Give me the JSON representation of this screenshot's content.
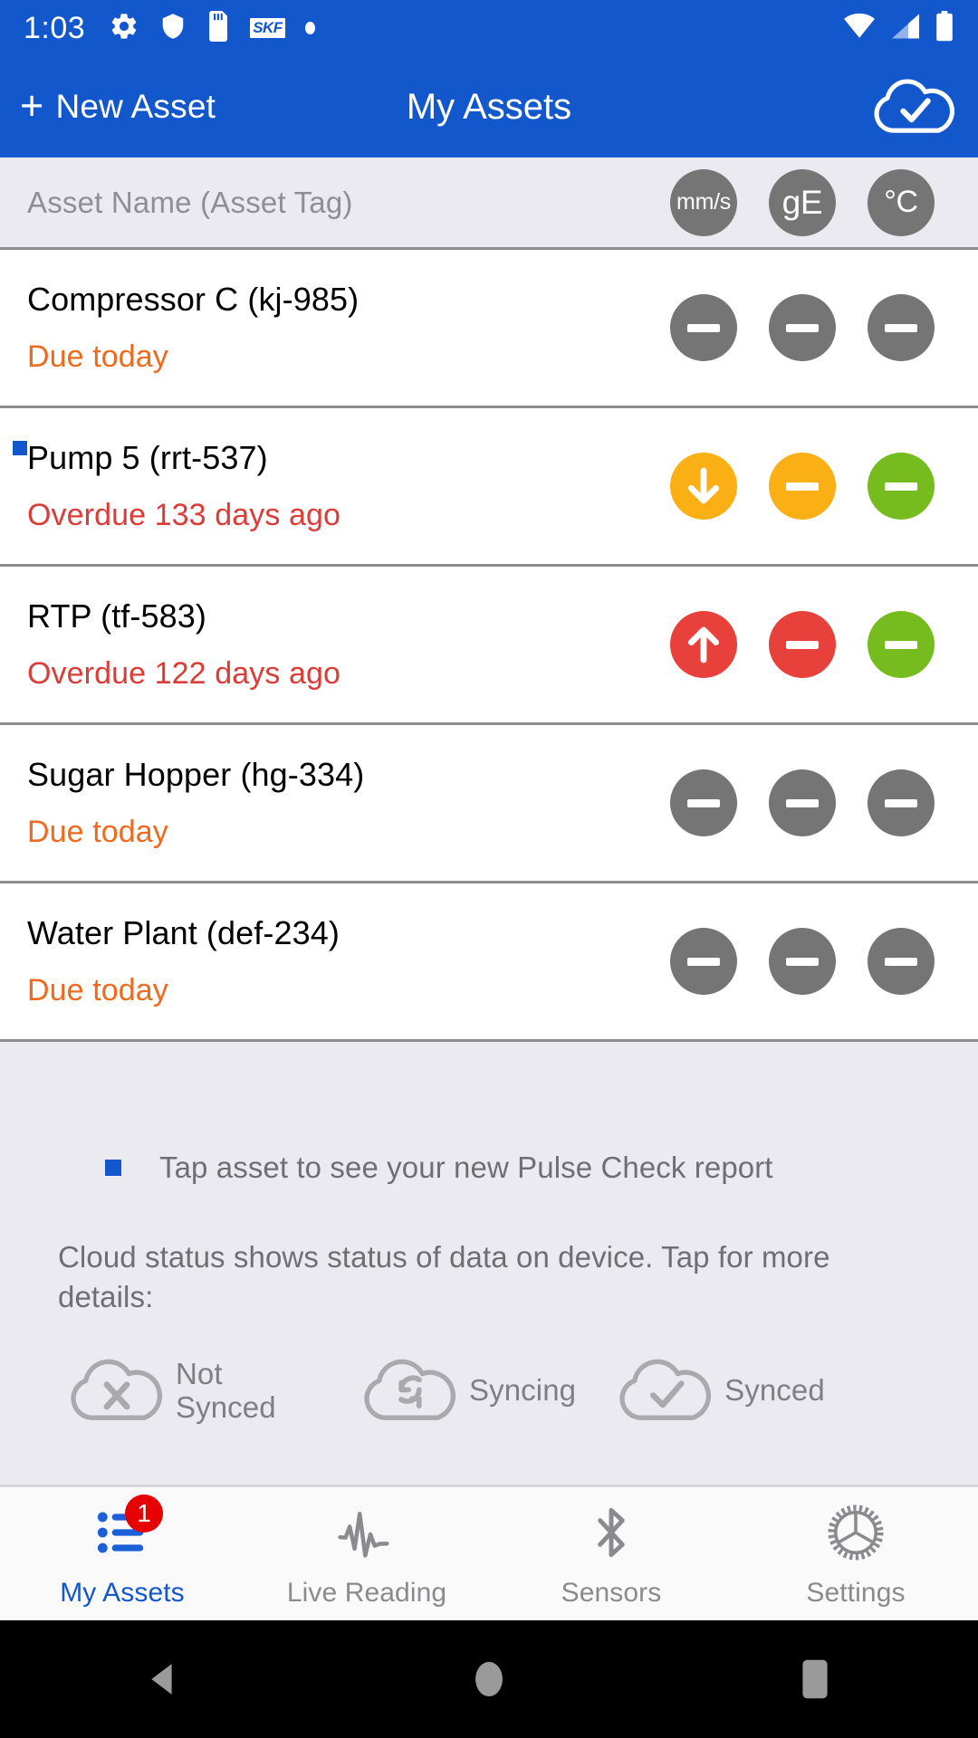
{
  "status_bar": {
    "time": "1:03",
    "left_icons": [
      "gear-icon",
      "shield-icon",
      "sd-card-icon",
      "skf-logo-icon",
      "dot-icon"
    ],
    "skf_text": "SKF",
    "right_icons": [
      "wifi-icon",
      "cellular-signal-icon",
      "battery-icon"
    ]
  },
  "app_bar": {
    "new_asset_label": "New Asset",
    "plus_glyph": "+",
    "title": "My Assets",
    "cloud_status_icon": "cloud-synced-icon"
  },
  "column_header": {
    "name_label": "Asset Name (Asset Tag)",
    "units": [
      {
        "label": "mm/s",
        "name": "unit-badge-velocity"
      },
      {
        "label": "gE",
        "name": "unit-badge-enveloping"
      },
      {
        "label": "°C",
        "name": "unit-badge-temperature"
      }
    ]
  },
  "assets": [
    {
      "name": "Compressor C (kj-985)",
      "due": "Due today",
      "due_state": "due-today",
      "is_new": false,
      "indicators": [
        {
          "color": "grey",
          "glyph": "dash"
        },
        {
          "color": "grey",
          "glyph": "dash"
        },
        {
          "color": "grey",
          "glyph": "dash"
        }
      ]
    },
    {
      "name": "Pump 5 (rrt-537)",
      "due": "Overdue 133 days ago",
      "due_state": "due-over",
      "is_new": true,
      "indicators": [
        {
          "color": "amber",
          "glyph": "arrow-down"
        },
        {
          "color": "amber",
          "glyph": "dash"
        },
        {
          "color": "green",
          "glyph": "dash"
        }
      ]
    },
    {
      "name": "RTP (tf-583)",
      "due": "Overdue 122 days ago",
      "due_state": "due-over",
      "is_new": false,
      "indicators": [
        {
          "color": "red",
          "glyph": "arrow-up"
        },
        {
          "color": "red",
          "glyph": "dash"
        },
        {
          "color": "green",
          "glyph": "dash"
        }
      ]
    },
    {
      "name": "Sugar Hopper (hg-334)",
      "due": "Due today",
      "due_state": "due-today",
      "is_new": false,
      "indicators": [
        {
          "color": "grey",
          "glyph": "dash"
        },
        {
          "color": "grey",
          "glyph": "dash"
        },
        {
          "color": "grey",
          "glyph": "dash"
        }
      ]
    },
    {
      "name": "Water Plant (def-234)",
      "due": "Due today",
      "due_state": "due-today",
      "is_new": false,
      "indicators": [
        {
          "color": "grey",
          "glyph": "dash"
        },
        {
          "color": "grey",
          "glyph": "dash"
        },
        {
          "color": "grey",
          "glyph": "dash"
        }
      ]
    }
  ],
  "info_panel": {
    "tip_text": "Tap asset to see your new Pulse Check report",
    "cloud_note": "Cloud status shows status of data on device. Tap for more details:",
    "legend": [
      {
        "label": "Not Synced",
        "icon": "cloud-not-synced-icon"
      },
      {
        "label": "Syncing",
        "icon": "cloud-syncing-icon"
      },
      {
        "label": "Synced",
        "icon": "cloud-synced-icon"
      }
    ]
  },
  "tab_bar": {
    "tabs": [
      {
        "label": "My Assets",
        "icon": "list-icon",
        "active": true,
        "badge": "1"
      },
      {
        "label": "Live Reading",
        "icon": "waveform-icon",
        "active": false,
        "badge": ""
      },
      {
        "label": "Sensors",
        "icon": "bluetooth-icon",
        "active": false,
        "badge": ""
      },
      {
        "label": "Settings",
        "icon": "gear-icon",
        "active": false,
        "badge": ""
      }
    ]
  },
  "nav_bar": {
    "buttons": [
      "back-triangle-icon",
      "home-circle-icon",
      "recents-square-icon"
    ]
  },
  "colors": {
    "brand_blue": "#1257CC",
    "due_today_orange": "#EE6A1E",
    "overdue_red": "#DC3C37",
    "status_grey": "#757575",
    "status_amber": "#FAAF14",
    "status_green": "#77BC1F",
    "status_red": "#E8403A",
    "badge_red": "#E60000",
    "panel_grey": "#ECEAF1"
  }
}
